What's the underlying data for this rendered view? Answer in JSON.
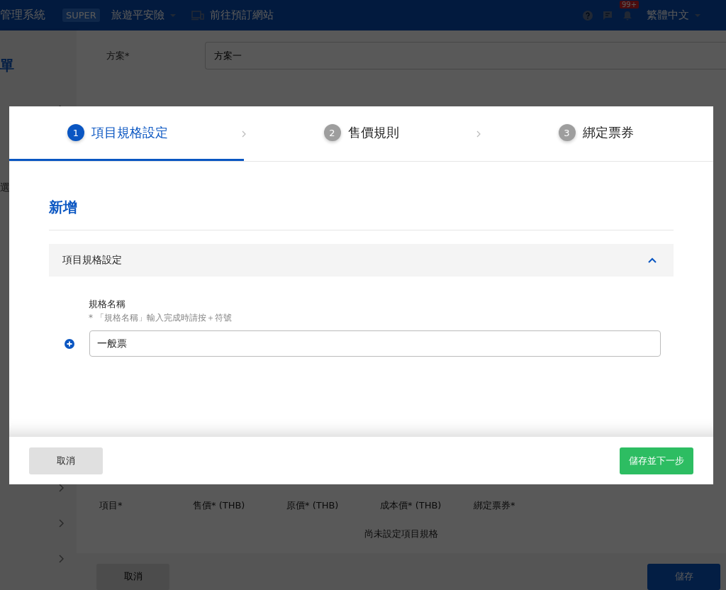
{
  "header": {
    "app_title": "管理系統",
    "badge": "SUPER",
    "product": "旅遊平安險",
    "site_link": "前往預訂網站",
    "notification_count": "99+",
    "language": "繁體中文"
  },
  "sidebar": {
    "heading": "單",
    "label": "選"
  },
  "page": {
    "plan_label": "方案*",
    "plan_value": "方案一",
    "table": {
      "columns": [
        "項目*",
        "售價* (THB)",
        "原價* (THB)",
        "成本價* (THB)",
        "綁定票券*"
      ],
      "empty_text": "尚未設定項目規格"
    },
    "buttons": {
      "cancel": "取消",
      "save": "儲存"
    }
  },
  "dialog": {
    "steps": [
      {
        "number": "1",
        "label": "項目規格設定",
        "selected": true
      },
      {
        "number": "2",
        "label": "售價規則",
        "selected": false
      },
      {
        "number": "3",
        "label": "綁定票券",
        "selected": false
      }
    ],
    "title": "新增",
    "section": {
      "title": "項目規格設定",
      "expanded": true,
      "field_label": "規格名稱",
      "hint": "* 「規格名稱」輸入完成時請按＋符號",
      "value": "一般票"
    },
    "buttons": {
      "cancel": "取消",
      "next": "儲存並下一步"
    }
  }
}
